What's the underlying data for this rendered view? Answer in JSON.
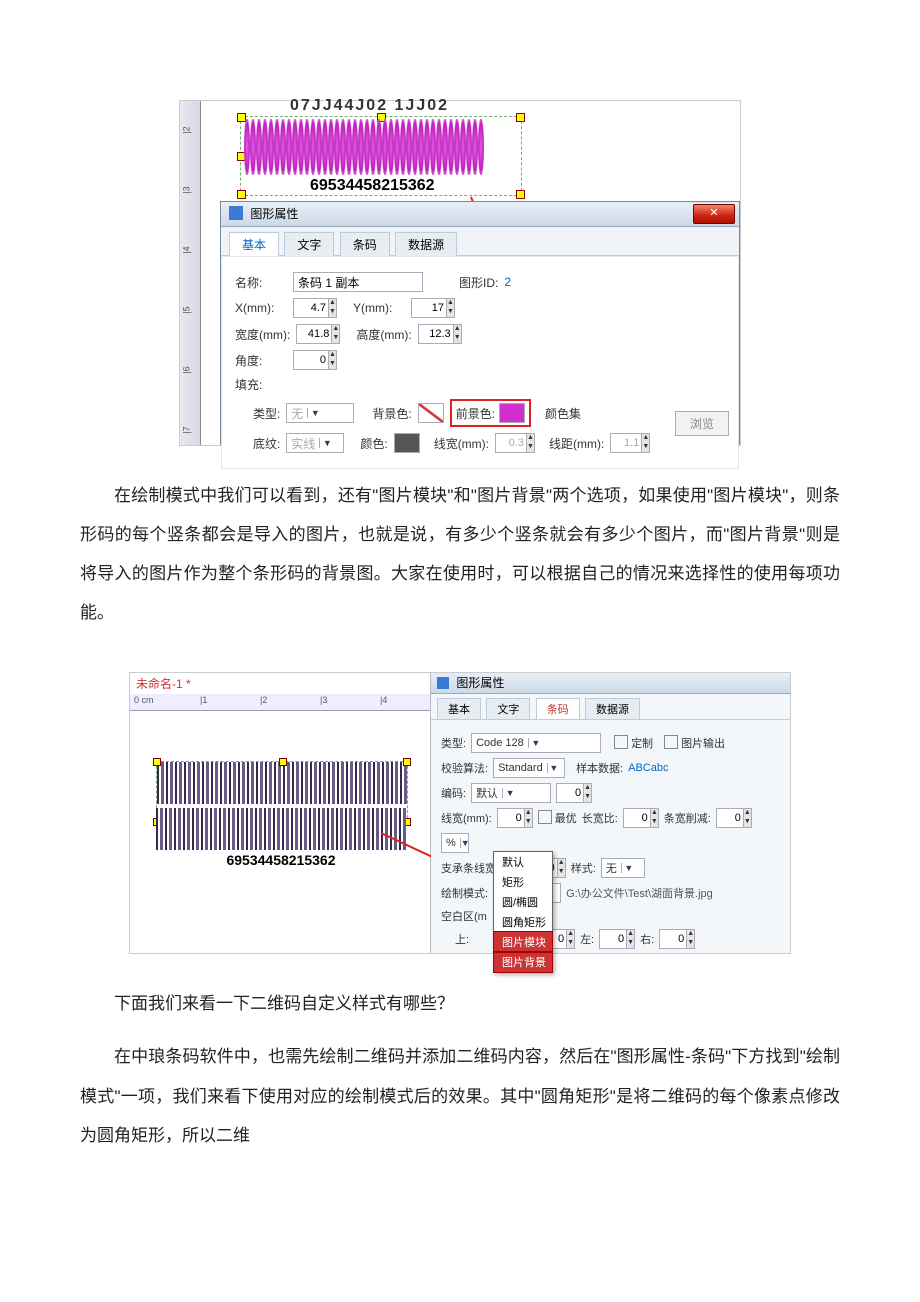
{
  "fig1": {
    "top_number": "07JJ44J02 1JJ02",
    "barcode_text": "69534458215362",
    "dialog_title": "图形属性",
    "tabs": [
      "基本",
      "文字",
      "条码",
      "数据源"
    ],
    "name_label": "名称:",
    "name_value": "条码 1 副本",
    "shape_id_label": "图形ID: ",
    "shape_id_value": "2",
    "x_label": "X(mm):",
    "x_value": "4.7",
    "y_label": "Y(mm):",
    "y_value": "17",
    "w_label": "宽度(mm):",
    "w_value": "41.8",
    "h_label": "高度(mm):",
    "h_value": "12.3",
    "angle_label": "角度:",
    "angle_value": "0",
    "fill_label": "填充:",
    "type_label": "类型:",
    "type_value": "无",
    "bgcolor_label": "背景色:",
    "fgcolor_label": "前景色:",
    "color_set_label": "颜色集",
    "bottom_line_label": "底纹:",
    "bottom_line_value": "实线",
    "color_label": "颜色:",
    "line_w_label": "线宽(mm):",
    "line_w_value": "0.3",
    "line_gap_label": "线距(mm):",
    "line_gap_value": "1.1",
    "browse": "浏览"
  },
  "para1": "在绘制模式中我们可以看到，还有\"图片模块\"和\"图片背景\"两个选项，如果使用\"图片模块\"，则条形码的每个竖条都会是导入的图片，也就是说，有多少个竖条就会有多少个图片，而\"图片背景\"则是将导入的图片作为整个条形码的背景图。大家在使用时，可以根据自己的情况来选择性的使用每项功能。",
  "fig2": {
    "doc_name": "未命名-1 *",
    "ruler_marks": [
      "0 cm",
      "|1",
      "|2",
      "|3",
      "|4"
    ],
    "barcode_text": "69534458215362",
    "dialog_title": "图形属性",
    "tabs": [
      "基本",
      "文字",
      "条码",
      "数据源"
    ],
    "type_label": "类型:",
    "type_value": "Code 128",
    "custom_label": "定制",
    "img_output_label": "图片输出",
    "check_algo_label": "校验算法:",
    "check_algo_value": "Standard",
    "sample_label": "样本数据:",
    "sample_value": "ABCabc",
    "encode_label": "编码:",
    "encode_value": "默认",
    "encode_num": "0",
    "line_w_label": "线宽(mm):",
    "line_w_value": "0",
    "best_label": "最优",
    "ratio_label": "长宽比:",
    "ratio_value": "0",
    "trim_label": "条宽削减:",
    "trim_value": "0",
    "trim_unit": "%",
    "bearer_label": "支承条线宽(mm):",
    "bearer_value": "0",
    "style_label": "样式:",
    "style_value": "无",
    "draw_mode_label": "绘制模式:",
    "draw_mode_value": "图片模块",
    "draw_mode_path": "G:\\办公文件\\Test\\湖面背景.jpg",
    "blank_label": "空白区(m",
    "top_label": "上:",
    "down_value": "0",
    "left_label": "左:",
    "left_value": "0",
    "right_label": "右:",
    "right_value": "0",
    "dd_options": [
      "默认",
      "矩形",
      "圆/椭圆",
      "圆角矩形",
      "图片模块",
      "图片背景"
    ]
  },
  "para2": "下面我们来看一下二维码自定义样式有哪些？",
  "para3": "在中琅条码软件中，也需先绘制二维码并添加二维码内容，然后在\"图形属性-条码\"下方找到\"绘制模式\"一项，我们来看下使用对应的绘制模式后的效果。其中\"圆角矩形\"是将二维码的每个像素点修改为圆角矩形，所以二维"
}
